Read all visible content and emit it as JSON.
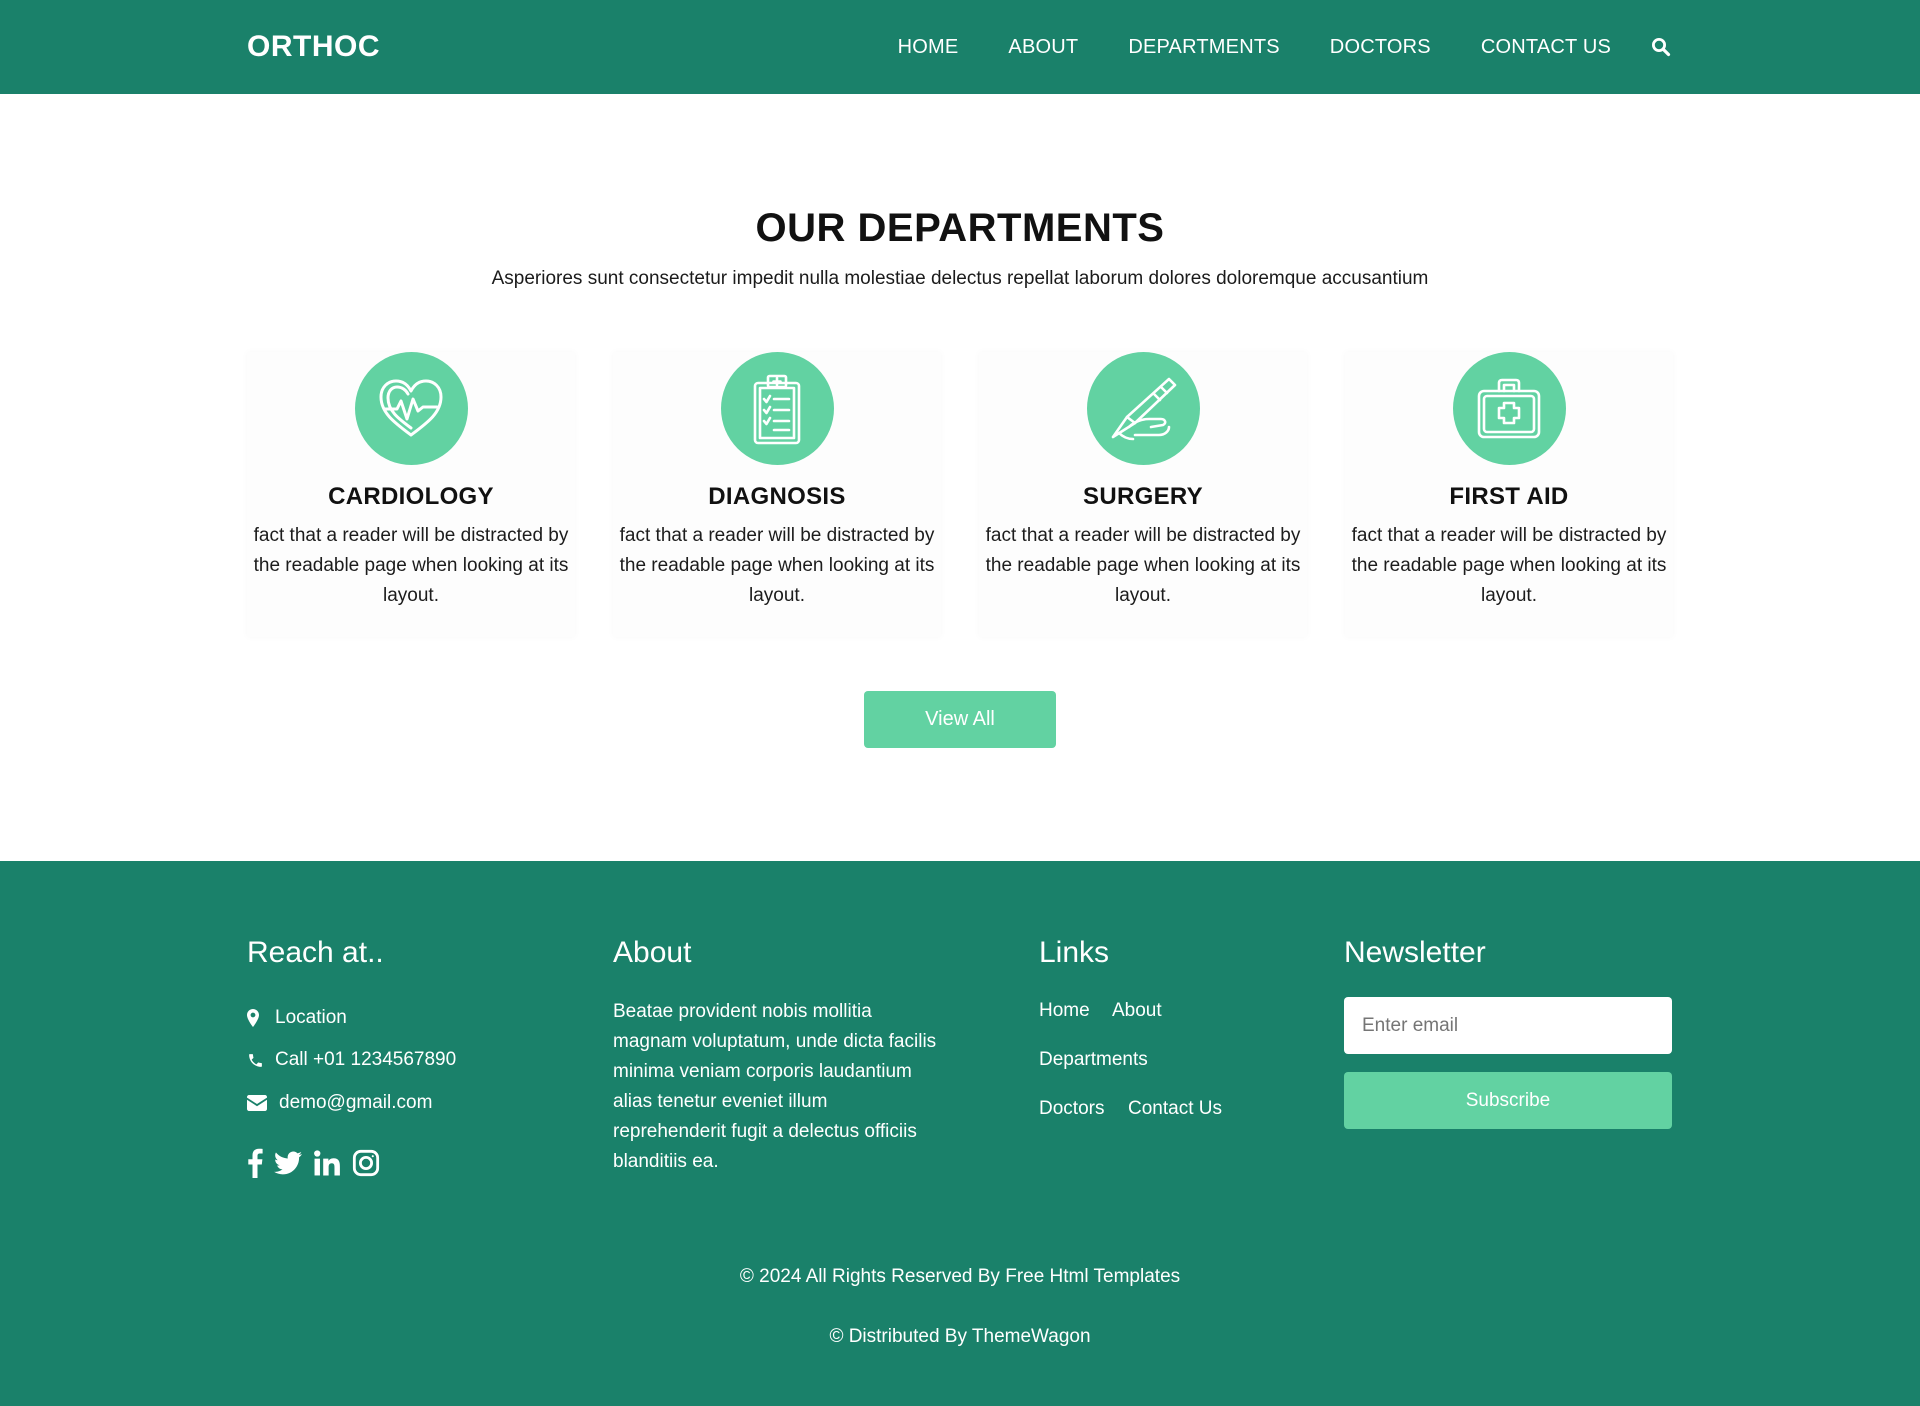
{
  "header": {
    "logo": "ORTHOC",
    "nav": [
      "HOME",
      "ABOUT",
      "DEPARTMENTS",
      "DOCTORS",
      "CONTACT US"
    ],
    "search_icon": "search-icon"
  },
  "departments": {
    "title": "OUR DEPARTMENTS",
    "subtitle": "Asperiores sunt consectetur impedit nulla molestiae delectus repellat laborum dolores doloremque accusantium",
    "cards": [
      {
        "icon": "heart-pulse-icon",
        "title": "CARDIOLOGY",
        "text": "fact that a reader will be distracted by the readable page when looking at its layout."
      },
      {
        "icon": "clipboard-icon",
        "title": "DIAGNOSIS",
        "text": "fact that a reader will be distracted by the readable page when looking at its layout."
      },
      {
        "icon": "scalpel-icon",
        "title": "SURGERY",
        "text": "fact that a reader will be distracted by the readable page when looking at its layout."
      },
      {
        "icon": "first-aid-kit-icon",
        "title": "FIRST AID",
        "text": "fact that a reader will be distracted by the readable page when looking at its layout."
      }
    ],
    "view_all": "View All"
  },
  "footer": {
    "reach": {
      "title": "Reach at..",
      "location": "Location",
      "phone": "Call +01 1234567890",
      "email": "demo@gmail.com",
      "social": [
        "facebook-icon",
        "twitter-icon",
        "linkedin-icon",
        "instagram-icon"
      ]
    },
    "about": {
      "title": "About",
      "text": "Beatae provident nobis mollitia magnam voluptatum, unde dicta facilis minima veniam corporis laudantium alias tenetur eveniet illum reprehenderit fugit a delectus officiis blanditiis ea."
    },
    "links": {
      "title": "Links",
      "items": [
        "Home",
        "About",
        "Departments",
        "Doctors",
        "Contact Us"
      ]
    },
    "newsletter": {
      "title": "Newsletter",
      "placeholder": "Enter email",
      "button": "Subscribe"
    },
    "copyright": "© 2024 All Rights Reserved By Free Html Templates",
    "distributed": "© Distributed By ThemeWagon"
  },
  "colors": {
    "primary": "#1a816a",
    "accent": "#62d2a2",
    "text": "#111111"
  }
}
